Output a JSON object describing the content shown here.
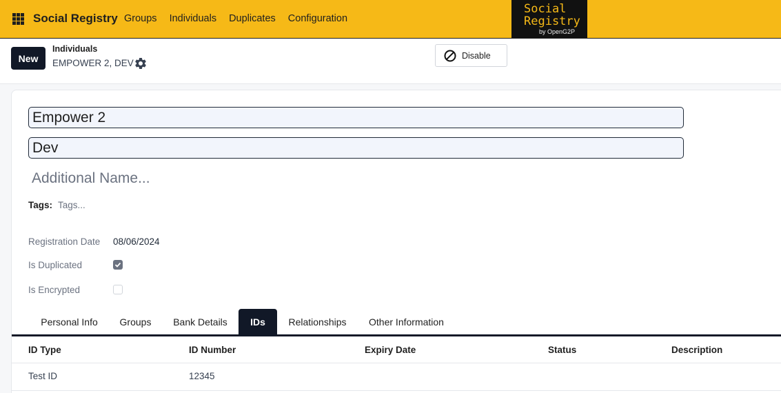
{
  "navbar": {
    "brand": "Social Registry",
    "menu": [
      "Groups",
      "Individuals",
      "Duplicates",
      "Configuration"
    ],
    "logo": {
      "line1": "Social",
      "line2": "Registry",
      "line3": "by OpenG2P"
    }
  },
  "control": {
    "new_label": "New",
    "breadcrumb_parent": "Individuals",
    "breadcrumb_current": "EMPOWER 2, DEV",
    "disable_label": "Disable"
  },
  "form": {
    "first_name": "Empower 2",
    "last_name": "Dev",
    "additional_placeholder": "Additional Name...",
    "tags_label": "Tags:",
    "tags_placeholder": "Tags...",
    "registration_date_label": "Registration Date",
    "registration_date": "08/06/2024",
    "is_duplicated_label": "Is Duplicated",
    "is_duplicated": true,
    "is_encrypted_label": "Is Encrypted",
    "is_encrypted": false
  },
  "tabs": [
    "Personal Info",
    "Groups",
    "Bank Details",
    "IDs",
    "Relationships",
    "Other Information"
  ],
  "active_tab": "IDs",
  "table": {
    "headers": [
      "ID Type",
      "ID Number",
      "Expiry Date",
      "Status",
      "Description"
    ],
    "rows": [
      [
        "Test ID",
        "12345",
        "",
        "",
        ""
      ]
    ]
  },
  "colors": {
    "accent": "#f6b917",
    "dark": "#111827"
  }
}
